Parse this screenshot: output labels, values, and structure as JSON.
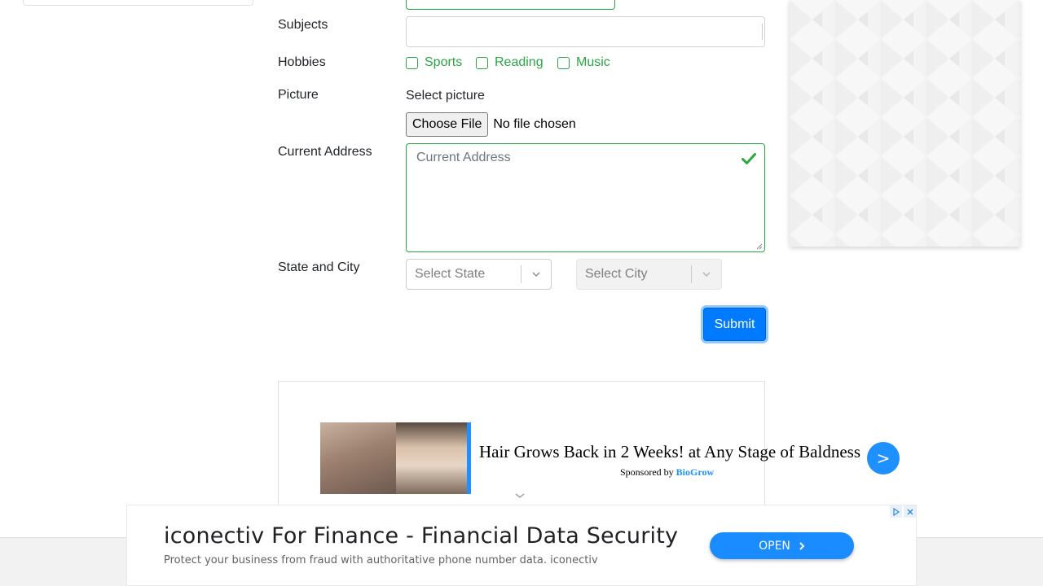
{
  "form": {
    "subjects_label": "Subjects",
    "hobbies_label": "Hobbies",
    "hobbies": [
      {
        "label": "Sports"
      },
      {
        "label": "Reading"
      },
      {
        "label": "Music"
      }
    ],
    "picture_label": "Picture",
    "picture_select_text": "Select picture",
    "file_button": "Choose File",
    "file_status": "No file chosen",
    "address_label": "Current Address",
    "address_placeholder": "Current Address",
    "state_city_label": "State and City",
    "state_placeholder": "Select State",
    "city_placeholder": "Select City",
    "submit_label": "Submit"
  },
  "ad": {
    "headline": "Hair Grows Back in 2 Weeks! at Any Stage of Baldness",
    "sponsored_prefix": "Sponsored by",
    "sponsor": "BioGrow",
    "arrow": ">"
  },
  "banner": {
    "title": "iconectiv For Finance - Financial Data Security",
    "description": "Protect your business from fraud with authoritative phone number data. iconectiv",
    "open_label": "OPEN"
  },
  "colors": {
    "accent": "#007bff",
    "valid": "#28a745",
    "ad_blue": "#1e90ff"
  }
}
